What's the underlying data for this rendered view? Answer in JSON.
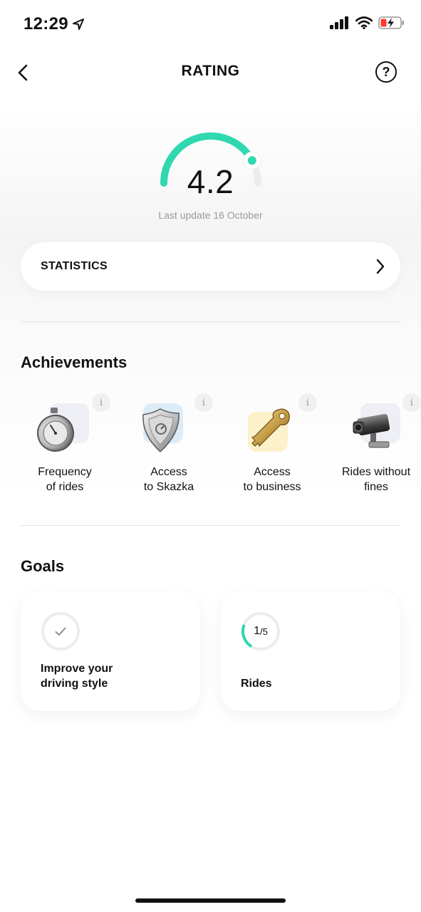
{
  "status_bar": {
    "time": "12:29",
    "battery_color": "#ff3b30"
  },
  "nav": {
    "title": "RATING",
    "help_glyph": "?"
  },
  "rating": {
    "value": "4.2",
    "last_update": "Last update 16 October",
    "accent_color": "#2fd8b0",
    "gauge_fraction": 0.84
  },
  "statistics": {
    "label": "STATISTICS"
  },
  "achievements": {
    "title": "Achievements",
    "info_glyph": "i",
    "items": [
      {
        "line1": "Frequency",
        "line2": "of rides",
        "icon": "stopwatch-icon",
        "bg_color": "#eeeef5"
      },
      {
        "line1": "Access",
        "line2": "to Skazka",
        "icon": "shield-icon",
        "bg_color": "#dcecf7"
      },
      {
        "line1": "Access",
        "line2": "to business",
        "icon": "key-icon",
        "bg_color": "#fdf1cc"
      },
      {
        "line1": "Rides without",
        "line2": "fines",
        "icon": "camera-icon",
        "bg_color": "#eeeef5"
      }
    ]
  },
  "goals": {
    "title": "Goals",
    "items": [
      {
        "line1": "Improve your",
        "line2": "driving style",
        "icon": "check-icon"
      },
      {
        "label": "Rides",
        "progress_done": "1",
        "progress_total": "5",
        "progress_fraction": 0.2
      }
    ]
  }
}
